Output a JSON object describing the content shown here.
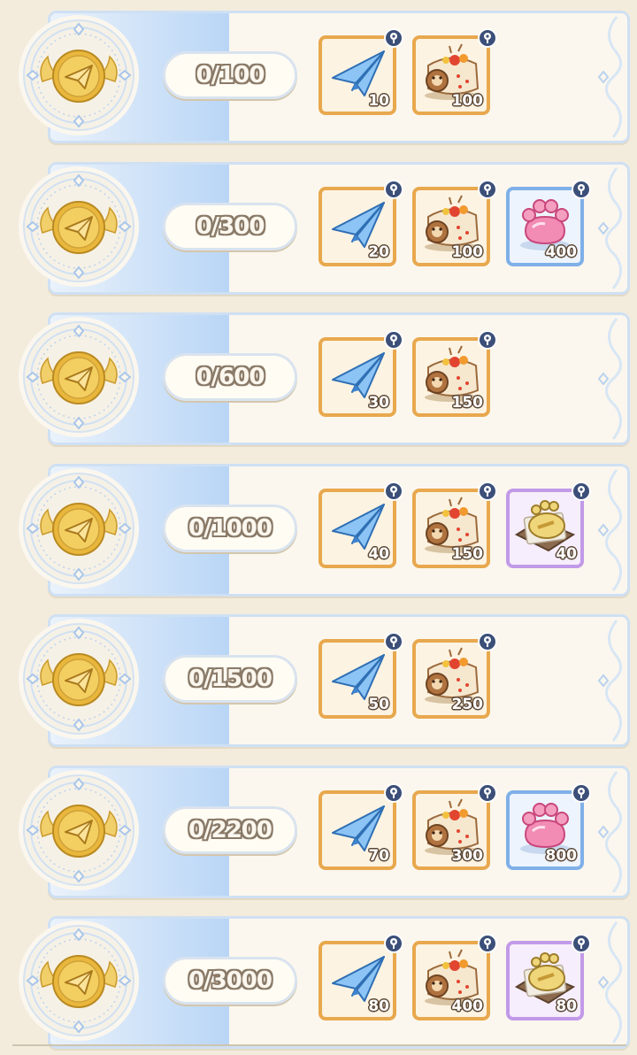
{
  "rows": [
    {
      "progress": "0/100",
      "rewards": [
        {
          "item": "paper-plane",
          "quantity": "10",
          "frame": "orange"
        },
        {
          "item": "roll-cake",
          "quantity": "100",
          "frame": "orange"
        }
      ]
    },
    {
      "progress": "0/300",
      "rewards": [
        {
          "item": "paper-plane",
          "quantity": "20",
          "frame": "orange"
        },
        {
          "item": "roll-cake",
          "quantity": "100",
          "frame": "orange"
        },
        {
          "item": "pink-paw-jelly",
          "quantity": "400",
          "frame": "blue"
        }
      ]
    },
    {
      "progress": "0/600",
      "rewards": [
        {
          "item": "paper-plane",
          "quantity": "30",
          "frame": "orange"
        },
        {
          "item": "roll-cake",
          "quantity": "150",
          "frame": "orange"
        }
      ]
    },
    {
      "progress": "0/1000",
      "rewards": [
        {
          "item": "paper-plane",
          "quantity": "40",
          "frame": "orange"
        },
        {
          "item": "roll-cake",
          "quantity": "150",
          "frame": "orange"
        },
        {
          "item": "paw-cookie",
          "quantity": "40",
          "frame": "purple"
        }
      ]
    },
    {
      "progress": "0/1500",
      "rewards": [
        {
          "item": "paper-plane",
          "quantity": "50",
          "frame": "orange"
        },
        {
          "item": "roll-cake",
          "quantity": "250",
          "frame": "orange"
        }
      ]
    },
    {
      "progress": "0/2200",
      "rewards": [
        {
          "item": "paper-plane",
          "quantity": "70",
          "frame": "orange"
        },
        {
          "item": "roll-cake",
          "quantity": "300",
          "frame": "orange"
        },
        {
          "item": "pink-paw-jelly",
          "quantity": "800",
          "frame": "blue"
        }
      ]
    },
    {
      "progress": "0/3000",
      "rewards": [
        {
          "item": "paper-plane",
          "quantity": "80",
          "frame": "orange"
        },
        {
          "item": "roll-cake",
          "quantity": "400",
          "frame": "orange"
        },
        {
          "item": "paw-cookie",
          "quantity": "80",
          "frame": "purple"
        }
      ]
    }
  ],
  "icons": {
    "medal": "gold-paper-plane-medal-icon",
    "info": "info-icon"
  },
  "colors": {
    "card_border": "#cfe0f3",
    "orange_frame": "#e8a84e",
    "blue_frame": "#7fb0e8",
    "purple_frame": "#c29ae8",
    "info_badge": "#3c4f78",
    "gold": "#e9b73c"
  }
}
